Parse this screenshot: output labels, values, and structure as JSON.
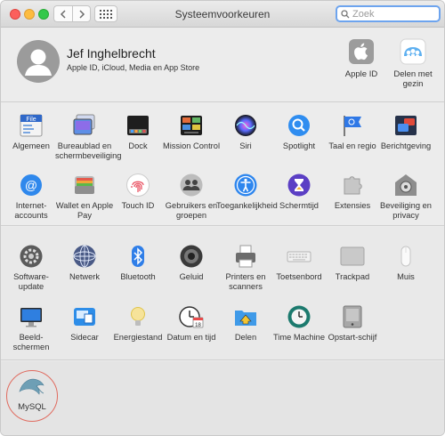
{
  "window": {
    "title": "Systeemvoorkeuren"
  },
  "search": {
    "placeholder": "Zoek",
    "value": ""
  },
  "user": {
    "name": "Jef Inghelbrecht",
    "subtitle": "Apple ID, iCloud, Media en App Store"
  },
  "top_tiles": [
    {
      "id": "apple-id",
      "label": "Apple ID",
      "icon": "apple-logo-icon"
    },
    {
      "id": "family-sharing",
      "label": "Delen met gezin",
      "icon": "family-sharing-icon"
    }
  ],
  "section1": [
    {
      "label": "Algemeen",
      "icon": "general-icon"
    },
    {
      "label": "Bureaublad en schermbeveiliging",
      "icon": "desktop-screensaver-icon"
    },
    {
      "label": "Dock",
      "icon": "dock-icon"
    },
    {
      "label": "Mission Control",
      "icon": "mission-control-icon"
    },
    {
      "label": "Siri",
      "icon": "siri-icon"
    },
    {
      "label": "Spotlight",
      "icon": "spotlight-icon"
    },
    {
      "label": "Taal en regio",
      "icon": "language-region-icon"
    },
    {
      "label": "Berichtgeving",
      "icon": "notifications-icon"
    },
    {
      "label": "Internet-accounts",
      "icon": "internet-accounts-icon"
    },
    {
      "label": "Wallet en Apple Pay",
      "icon": "wallet-icon"
    },
    {
      "label": "Touch ID",
      "icon": "touch-id-icon"
    },
    {
      "label": "Gebruikers en groepen",
      "icon": "users-groups-icon"
    },
    {
      "label": "Toegankelijkheid",
      "icon": "accessibility-icon"
    },
    {
      "label": "Schermtijd",
      "icon": "screen-time-icon"
    },
    {
      "label": "Extensies",
      "icon": "extensions-icon"
    },
    {
      "label": "Beveiliging en privacy",
      "icon": "security-privacy-icon"
    }
  ],
  "section2": [
    {
      "label": "Software-update",
      "icon": "software-update-icon"
    },
    {
      "label": "Netwerk",
      "icon": "network-icon"
    },
    {
      "label": "Bluetooth",
      "icon": "bluetooth-icon"
    },
    {
      "label": "Geluid",
      "icon": "sound-icon"
    },
    {
      "label": "Printers en scanners",
      "icon": "printer-icon"
    },
    {
      "label": "Toetsenbord",
      "icon": "keyboard-icon"
    },
    {
      "label": "Trackpad",
      "icon": "trackpad-icon"
    },
    {
      "label": "Muis",
      "icon": "mouse-icon"
    },
    {
      "label": "Beeld-schermen",
      "icon": "displays-icon"
    },
    {
      "label": "Sidecar",
      "icon": "sidecar-icon"
    },
    {
      "label": "Energiestand",
      "icon": "energy-saver-icon"
    },
    {
      "label": "Datum en tijd",
      "icon": "date-time-icon"
    },
    {
      "label": "Delen",
      "icon": "sharing-icon"
    },
    {
      "label": "Time Machine",
      "icon": "time-machine-icon"
    },
    {
      "label": "Opstart-schijf",
      "icon": "startup-disk-icon"
    }
  ],
  "section3": [
    {
      "label": "MySQL",
      "icon": "mysql-dolphin-icon"
    }
  ],
  "colors": {
    "accent": "#3478f6",
    "search_focus": "#6da4ee",
    "mysql_highlight_ring": "#e06b5f"
  }
}
